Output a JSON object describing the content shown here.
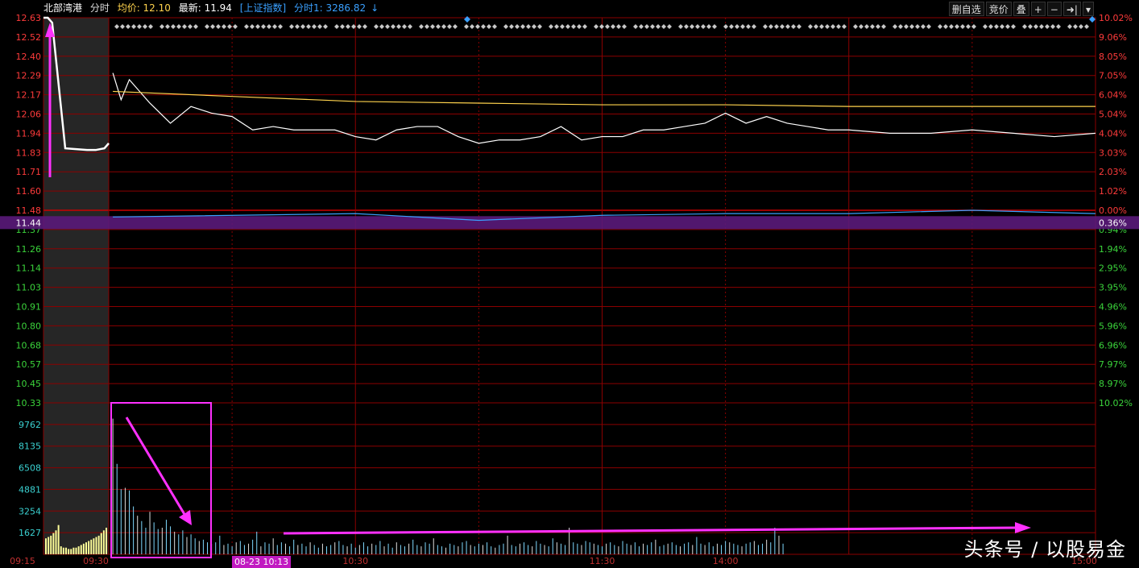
{
  "header": {
    "stock_name": "北部湾港",
    "mode": "分时",
    "avg_label": "均价: 12.10",
    "last_label": "最新: 11.94",
    "index_label": "[上证指数]",
    "index_value": "分时1: 3286.82",
    "index_arrow": "↓"
  },
  "toolbar": {
    "delete_watch": "删自选",
    "auction": "竞价",
    "overlay": "叠",
    "zoom_in": "+",
    "zoom_out": "−",
    "next": "➜|",
    "dropdown": "▾"
  },
  "price_axis": {
    "left_labels": [
      "12.63",
      "12.52",
      "12.40",
      "12.29",
      "12.17",
      "12.06",
      "11.94",
      "11.83",
      "11.71",
      "11.60",
      "11.48",
      "11.37",
      "11.26",
      "11.14",
      "11.03",
      "10.91",
      "10.80",
      "10.68",
      "10.57",
      "10.45",
      "10.33"
    ],
    "right_labels": [
      "10.02%",
      "9.06%",
      "8.05%",
      "7.05%",
      "6.04%",
      "5.04%",
      "4.04%",
      "3.03%",
      "2.03%",
      "1.02%",
      "0.00%",
      "0.94%",
      "1.94%",
      "2.95%",
      "3.95%",
      "4.96%",
      "5.96%",
      "6.96%",
      "7.97%",
      "8.97%",
      "10.02%"
    ],
    "crosshair_price": "11.44",
    "crosshair_pct": "0.36%",
    "prev_close": 11.48
  },
  "volume_axis": {
    "labels": [
      "9762",
      "8135",
      "6508",
      "4881",
      "3254",
      "1627"
    ]
  },
  "time_axis": {
    "labels": [
      "09:15",
      "09:30",
      "10:30",
      "11:30",
      "14:00",
      "15:00"
    ],
    "cursor_label": "08-23 10:13"
  },
  "colors": {
    "up": "#ff3b3b",
    "down": "#3bd43b",
    "price_line": "#ffffff",
    "avg_line": "#ffd34d",
    "index_line": "#3aa0ff",
    "grid": "#8b0000",
    "annotation": "#ff30ff",
    "crosshair": "#5a1a7a"
  },
  "chart_data": {
    "type": "line",
    "title": "北部湾港 分时",
    "series": [
      {
        "name": "最新",
        "x": [
          "09:31",
          "09:33",
          "09:35",
          "09:40",
          "09:45",
          "09:50",
          "09:55",
          "10:00",
          "10:05",
          "10:10",
          "10:15",
          "10:20",
          "10:25",
          "10:30",
          "10:35",
          "10:40",
          "10:45",
          "10:50",
          "10:55",
          "11:00",
          "11:05",
          "11:10",
          "11:15",
          "11:20",
          "11:25",
          "11:30",
          "13:05",
          "13:10",
          "13:15",
          "13:20",
          "13:25",
          "13:30",
          "13:35",
          "13:40",
          "13:45",
          "13:50",
          "13:55",
          "14:00",
          "14:10",
          "14:20",
          "14:30",
          "14:40",
          "14:50",
          "15:00"
        ],
        "values": [
          12.3,
          12.14,
          12.26,
          12.12,
          12.0,
          12.1,
          12.06,
          12.04,
          11.96,
          11.98,
          11.96,
          11.96,
          11.96,
          11.92,
          11.9,
          11.96,
          11.98,
          11.98,
          11.92,
          11.88,
          11.9,
          11.9,
          11.92,
          11.98,
          11.9,
          11.92,
          11.92,
          11.96,
          11.96,
          11.98,
          12.0,
          12.06,
          12.0,
          12.04,
          12.0,
          11.98,
          11.96,
          11.96,
          11.94,
          11.94,
          11.96,
          11.94,
          11.92,
          11.94
        ]
      },
      {
        "name": "均价",
        "x": [
          "09:31",
          "10:00",
          "10:30",
          "11:00",
          "11:30",
          "13:30",
          "14:00",
          "14:30",
          "15:00"
        ],
        "values": [
          12.19,
          12.16,
          12.13,
          12.12,
          12.11,
          12.11,
          12.1,
          12.1,
          12.1
        ]
      },
      {
        "name": "上证指数",
        "x": [
          "09:31",
          "10:30",
          "11:00",
          "11:30",
          "13:30",
          "14:00",
          "14:30",
          "15:00"
        ],
        "values": [
          11.44,
          11.46,
          11.42,
          11.45,
          11.46,
          11.46,
          11.48,
          11.46
        ]
      }
    ],
    "auction": {
      "x": [
        "09:15",
        "09:16",
        "09:17",
        "09:20",
        "09:25",
        "09:27",
        "09:29",
        "09:30"
      ],
      "values": [
        12.63,
        12.63,
        12.6,
        11.85,
        11.84,
        11.84,
        11.85,
        11.88
      ]
    },
    "volume": {
      "x_desc": "per minute from 09:31",
      "values": [
        10200,
        6800,
        4900,
        5000,
        4800,
        3600,
        2900,
        2500,
        2000,
        3200,
        2400,
        1900,
        2000,
        2600,
        2100,
        1700,
        1500,
        1800,
        1300,
        1500,
        1200,
        1000,
        1100,
        900,
        800,
        900,
        1400,
        700,
        800,
        600,
        900,
        1000,
        700,
        800,
        1100,
        1700,
        600,
        900,
        800,
        1200,
        700,
        900,
        800,
        600,
        1100,
        700,
        800,
        600,
        900,
        700,
        500,
        800,
        600,
        700,
        900,
        1000,
        700,
        600,
        800,
        500,
        700,
        900,
        600,
        800,
        700,
        1000,
        600,
        800,
        500,
        900,
        700,
        600,
        800,
        1100,
        700,
        600,
        900,
        800,
        1200,
        700,
        600,
        500,
        800,
        700,
        600,
        900,
        1000,
        700,
        600,
        800,
        700,
        900,
        600,
        500,
        700,
        800,
        1400,
        700,
        600,
        800,
        900,
        700,
        600,
        1000,
        800,
        700,
        600,
        1200,
        900,
        800,
        700,
        2000,
        900,
        800,
        700,
        1000,
        900,
        800,
        700,
        600,
        800,
        900,
        700,
        600,
        1000,
        800,
        700,
        900,
        600,
        800,
        700,
        900,
        1100,
        600,
        700,
        800,
        900,
        700,
        600,
        800,
        900,
        700,
        1300,
        800,
        700,
        900,
        600,
        800,
        700,
        1000,
        900,
        800,
        700,
        600,
        800,
        900,
        1000,
        700,
        800,
        1100,
        900,
        2000,
        1400,
        800
      ]
    },
    "auction_volume": [
      1200,
      1300,
      1400,
      1600,
      1800,
      2200,
      600,
      500,
      500,
      400,
      400,
      500,
      500,
      600,
      700,
      800,
      900,
      1000,
      1100,
      1200,
      1300,
      1400,
      1600,
      1800,
      2000
    ],
    "ylim": [
      10.33,
      12.63
    ],
    "volume_ylim": [
      0,
      11389
    ]
  },
  "watermark": "头条号 / 以股易金"
}
